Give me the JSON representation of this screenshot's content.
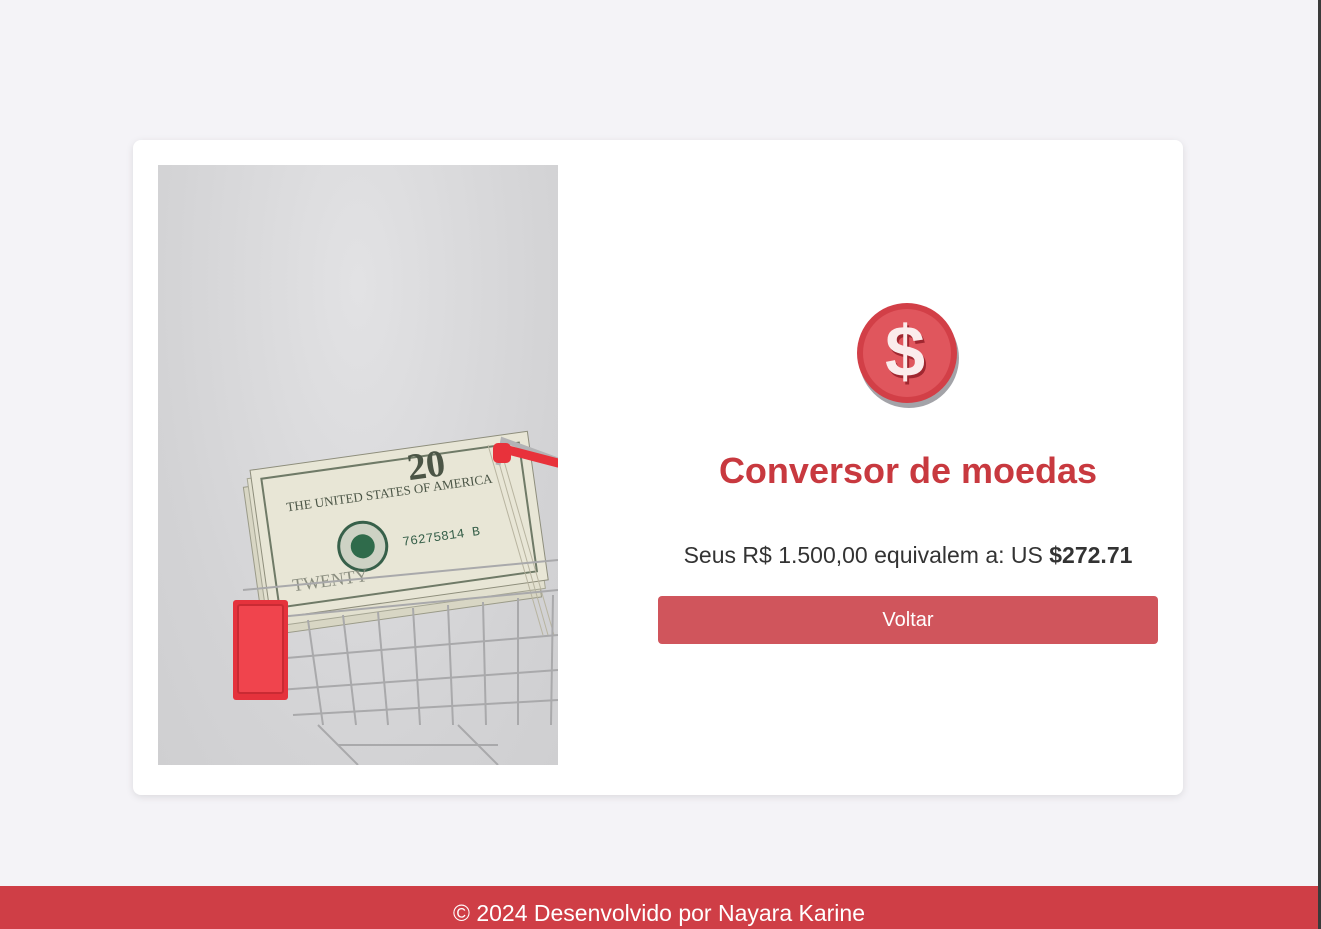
{
  "converter": {
    "title": "Conversor de moedas",
    "result_prefix": "Seus R$ 1.500,00 equivalem a: US ",
    "result_value": "$272.71",
    "back_label": "Voltar"
  },
  "footer": {
    "text": "© 2024 Desenvolvido por Nayara Karine"
  },
  "icons": {
    "coin": "dollar-coin-icon",
    "photo": "money-in-shopping-cart-photo"
  },
  "colors": {
    "accent": "#c8393f",
    "button": "#d0555c",
    "footer": "#cf3e46",
    "background": "#f4f3f7"
  }
}
